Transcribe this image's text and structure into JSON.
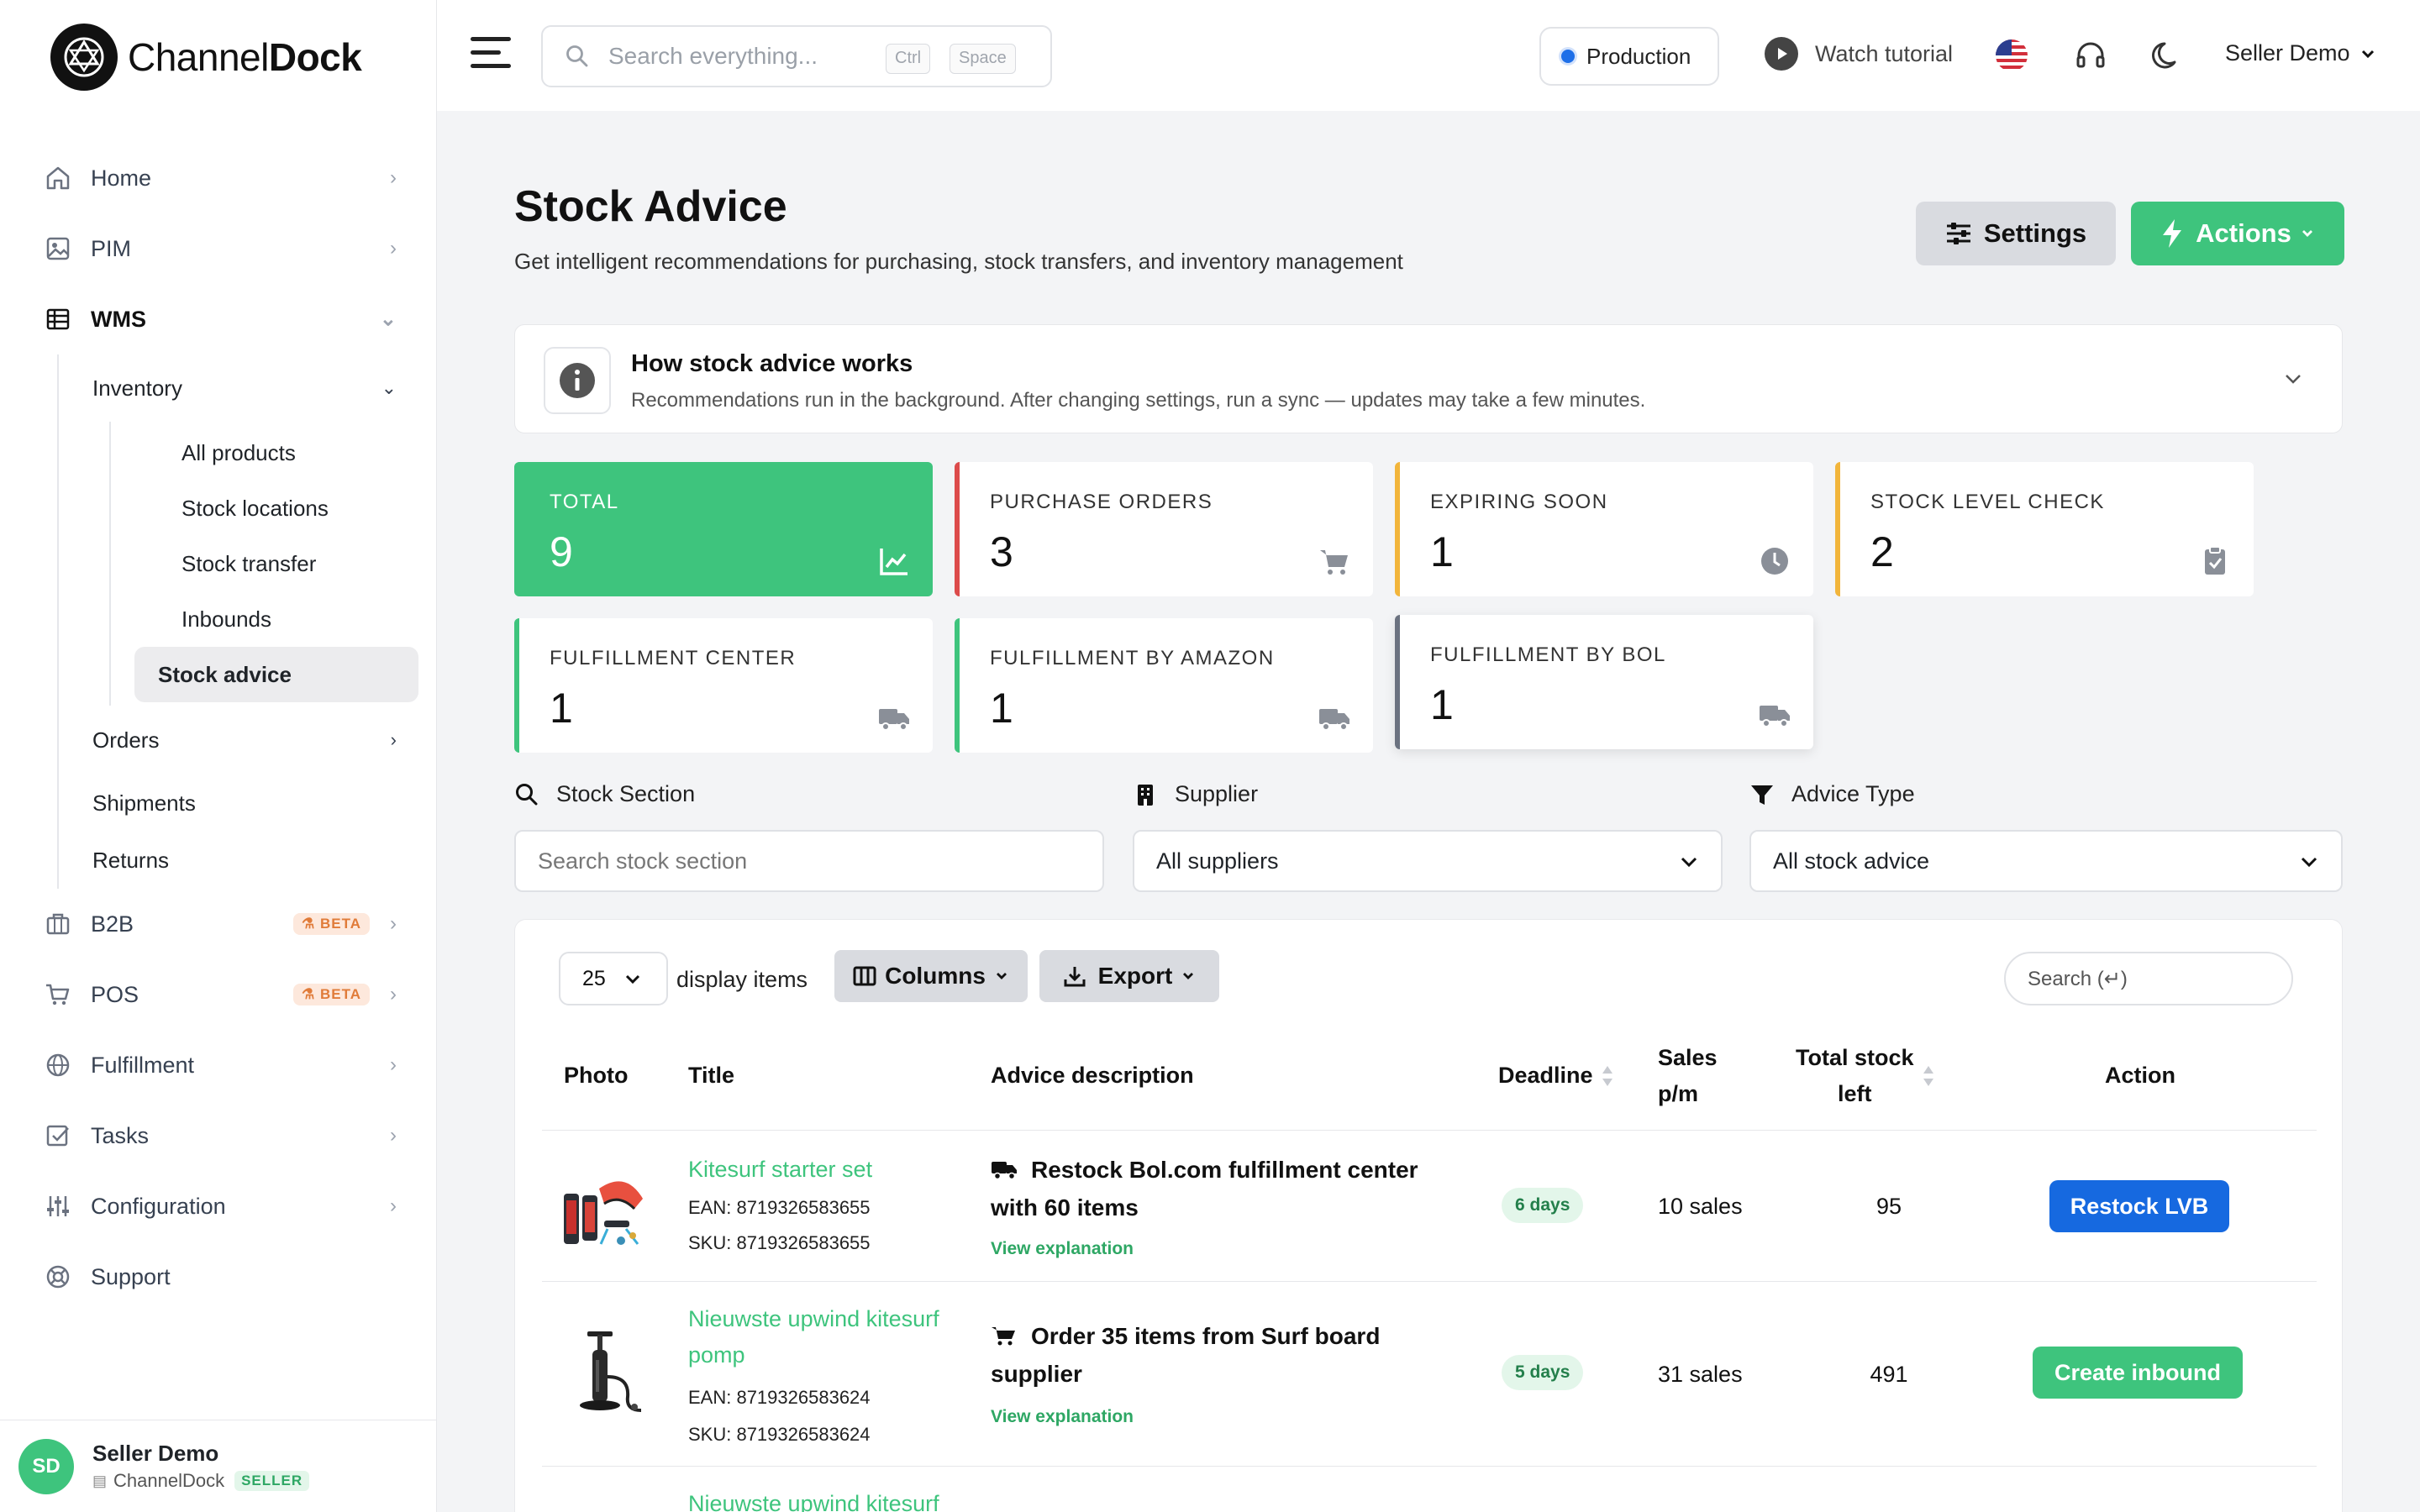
{
  "brand": {
    "name_light": "Channel",
    "name_bold": "Dock"
  },
  "topbar": {
    "search_placeholder": "Search everything...",
    "kbd_ctrl": "Ctrl",
    "kbd_space": "Space",
    "environment": "Production",
    "tutorial": "Watch tutorial",
    "user": "Seller Demo"
  },
  "sidebar": {
    "items": [
      {
        "label": "Home",
        "icon": "home-icon"
      },
      {
        "label": "PIM",
        "icon": "image-icon"
      },
      {
        "label": "WMS",
        "icon": "table-icon"
      }
    ],
    "wms_sub": {
      "inventory": "Inventory",
      "inventory_items": [
        "All products",
        "Stock locations",
        "Stock transfer",
        "Inbounds",
        "Stock advice"
      ],
      "orders": "Orders",
      "shipments": "Shipments",
      "returns": "Returns"
    },
    "lower_items": [
      {
        "label": "B2B",
        "badge": "BETA"
      },
      {
        "label": "POS",
        "badge": "BETA"
      },
      {
        "label": "Fulfillment"
      },
      {
        "label": "Tasks"
      },
      {
        "label": "Configuration"
      },
      {
        "label": "Support"
      }
    ],
    "user": {
      "initials": "SD",
      "name": "Seller Demo",
      "company": "ChannelDock",
      "role": "SELLER"
    }
  },
  "page": {
    "title": "Stock Advice",
    "subtitle": "Get intelligent recommendations for purchasing, stock transfers, and inventory management",
    "settings_label": "Settings",
    "actions_label": "Actions"
  },
  "info": {
    "title": "How stock advice works",
    "text": "Recommendations run in the background. After changing settings, run a sync — updates may take a few minutes."
  },
  "stats": [
    {
      "label": "TOTAL",
      "value": "9",
      "icon": "chart-line-icon",
      "color": "#3ec47d"
    },
    {
      "label": "PURCHASE ORDERS",
      "value": "3",
      "icon": "cart-icon",
      "color": "#dc4b4b"
    },
    {
      "label": "EXPIRING SOON",
      "value": "1",
      "icon": "clock-icon",
      "color": "#f2b53b"
    },
    {
      "label": "STOCK LEVEL CHECK",
      "value": "2",
      "icon": "clipboard-check-icon",
      "color": "#f2b53b"
    },
    {
      "label": "FULFILLMENT CENTER",
      "value": "1",
      "icon": "truck-icon",
      "color": "#3ec47d"
    },
    {
      "label": "FULFILLMENT BY AMAZON",
      "value": "1",
      "icon": "truck-icon",
      "color": "#3ec47d"
    },
    {
      "label": "FULFILLMENT BY BOL",
      "value": "1",
      "icon": "truck-icon",
      "color": "#6b7280"
    }
  ],
  "filters": {
    "section_label": "Stock Section",
    "section_placeholder": "Search stock section",
    "supplier_label": "Supplier",
    "supplier_value": "All suppliers",
    "type_label": "Advice Type",
    "type_value": "All stock advice"
  },
  "table": {
    "per_page": "25",
    "per_page_label": "display items",
    "columns_btn": "Columns",
    "export_btn": "Export",
    "search_placeholder": "Search (↵)",
    "headers": {
      "photo": "Photo",
      "title": "Title",
      "advice": "Advice description",
      "deadline": "Deadline",
      "sales_1": "Sales",
      "sales_2": "p/m",
      "stock_1": "Total stock",
      "stock_2": "left",
      "action": "Action"
    },
    "rows": [
      {
        "title": "Kitesurf starter set",
        "ean": "EAN: 8719326583655",
        "sku": "SKU: 8719326583655",
        "advice_l1": "Restock Bol.com fulfillment center",
        "advice_l2": "with 60 items",
        "advice_icon": "truck-icon",
        "explanation": "View explanation",
        "deadline": "6 days",
        "sales": "10 sales",
        "stock": "95",
        "action": "Restock LVB",
        "action_color": "#1669e0"
      },
      {
        "title_l1": "Nieuwste upwind kitesurf",
        "title_l2": "pomp",
        "ean": "EAN: 8719326583624",
        "sku": "SKU: 8719326583624",
        "advice_l1": "Order 35 items from Surf board",
        "advice_l2": "supplier",
        "advice_icon": "cart-icon",
        "explanation": "View explanation",
        "deadline": "5 days",
        "sales": "31 sales",
        "stock": "491",
        "action": "Create inbound",
        "action_color": "#3ec47d"
      },
      {
        "title_l1": "Nieuwste upwind kitesurf"
      }
    ]
  }
}
